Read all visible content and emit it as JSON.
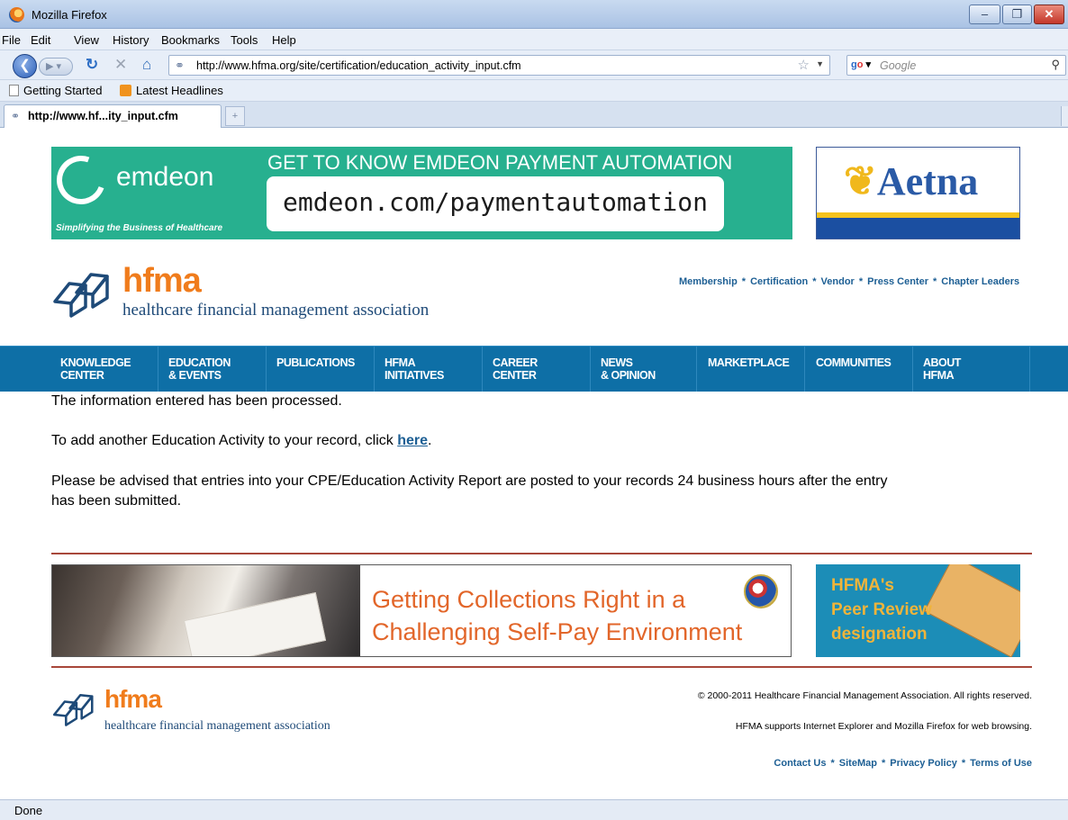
{
  "window": {
    "title": "Mozilla Firefox",
    "min_icon": "minimize-icon",
    "max_icon": "restore-icon",
    "close_icon": "close-icon"
  },
  "menu": [
    "File",
    "Edit",
    "View",
    "History",
    "Bookmarks",
    "Tools",
    "Help"
  ],
  "nav": {
    "url": "http://www.hfma.org/site/certification/education_activity_input.cfm",
    "search_placeholder": "Google"
  },
  "bookmarks": [
    "Getting Started",
    "Latest Headlines"
  ],
  "tab": {
    "label": "http://www.hf...ity_input.cfm",
    "new_tab": "+"
  },
  "ads": {
    "emdeon": {
      "brand": "emdeon",
      "tagline": "Simplifying the Business of Healthcare",
      "headline": "GET TO KNOW EMDEON PAYMENT AUTOMATION",
      "url": "emdeon.com/paymentautomation"
    },
    "aetna": {
      "brand": "Aetna"
    },
    "collections": {
      "line1": "Getting Collections Right in a",
      "line2": "Challenging Self-Pay Environment"
    },
    "peer": {
      "line1": "HFMA's",
      "line2": "Peer Review",
      "line3": "designation"
    }
  },
  "header": {
    "logo_word": "hfma",
    "logo_sub": "healthcare financial management association",
    "links": [
      "Membership",
      "Certification",
      "Vendor",
      "Press Center",
      "Chapter Leaders"
    ]
  },
  "mainnav": [
    {
      "line1": "KNOWLEDGE",
      "line2": "CENTER"
    },
    {
      "line1": "EDUCATION",
      "line2": "& EVENTS"
    },
    {
      "line1": "PUBLICATIONS",
      "line2": ""
    },
    {
      "line1": "HFMA",
      "line2": "INITIATIVES"
    },
    {
      "line1": "CAREER",
      "line2": "CENTER"
    },
    {
      "line1": "NEWS",
      "line2": "& OPINION"
    },
    {
      "line1": "MARKETPLACE",
      "line2": ""
    },
    {
      "line1": "COMMUNITIES",
      "line2": ""
    },
    {
      "line1": "ABOUT",
      "line2": "HFMA"
    }
  ],
  "content": {
    "processed": "The information entered has been processed.",
    "add_prefix": "To add another Education Activity to your record, click ",
    "add_link": "here",
    "add_suffix": ".",
    "advised_line1": "Please be advised that entries into your CPE/Education Activity Report are posted to your records 24 business hours after the entry",
    "advised_line2": "has been submitted."
  },
  "footer": {
    "logo_word": "hfma",
    "logo_sub": "healthcare financial management association",
    "copyright": "© 2000-2011 Healthcare Financial Management Association. All rights reserved.",
    "browsers": "HFMA supports Internet Explorer and Mozilla Firefox for web browsing.",
    "links": [
      "Contact Us",
      "SiteMap",
      "Privacy Policy",
      "Terms of Use"
    ]
  },
  "status": "Done"
}
